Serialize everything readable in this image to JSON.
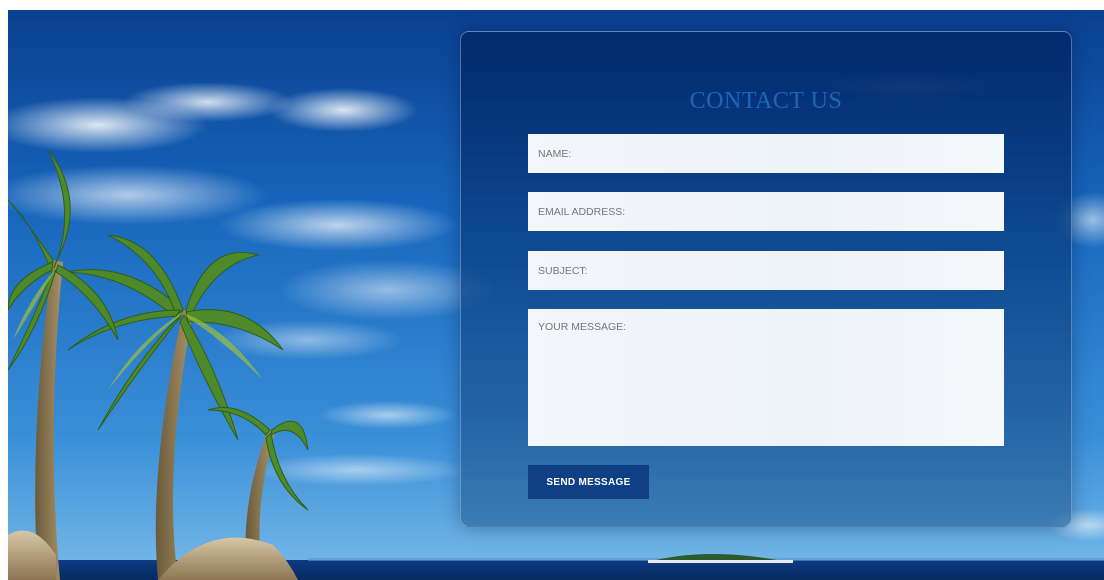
{
  "contact": {
    "title": "CONTACT US",
    "fields": {
      "name_placeholder": "NAME:",
      "email_placeholder": "EMAIL ADDRESS:",
      "subject_placeholder": "SUBJECT:",
      "message_placeholder": "YOUR MESSAGE:"
    },
    "send_label": "SEND MESSAGE"
  },
  "colors": {
    "title": "#1a66b8",
    "button": "#0f3f85",
    "panel": "#022668",
    "field": "#f3f6fa"
  }
}
